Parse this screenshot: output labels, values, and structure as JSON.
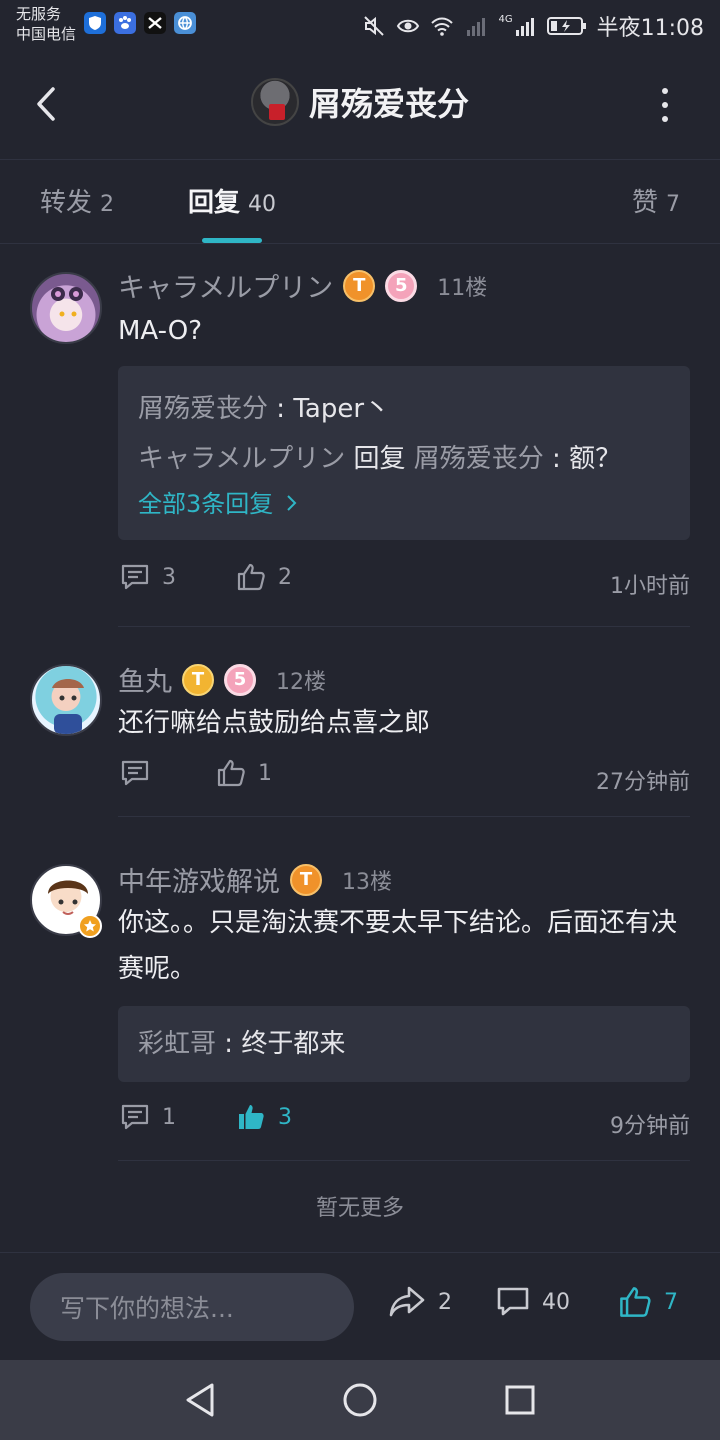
{
  "status_bar": {
    "carrier_line1": "无服务",
    "carrier_line2": "中国电信",
    "time": "半夜11:08",
    "network": "4G"
  },
  "header": {
    "title": "屑殇爱丧分"
  },
  "tabs": [
    {
      "label": "转发",
      "count": "2"
    },
    {
      "label": "回复",
      "count": "40",
      "active": true
    },
    {
      "label": "赞",
      "count": "7"
    }
  ],
  "comments": [
    {
      "username": "キャラメルプリン",
      "floor": "11楼",
      "text": "MA-O?",
      "replies": [
        {
          "name": "屑殇爱丧分",
          "sep": " : ",
          "text": "Taper丶"
        },
        {
          "name": "キャラメルプリン",
          "mid": " 回复 ",
          "name2": "屑殇爱丧分",
          "sep": " : ",
          "text": "额？"
        }
      ],
      "more_replies": "全部3条回复",
      "comment_count": "3",
      "like_count": "2",
      "time": "1小时前"
    },
    {
      "username": "鱼丸",
      "floor": "12楼",
      "text": "还行嘛给点鼓励给点喜之郎",
      "comment_count": "",
      "like_count": "1",
      "time": "27分钟前"
    },
    {
      "username": "中年游戏解说",
      "floor": "13楼",
      "text": "你这。。只是淘汰赛不要太早下结论。后面还有决赛呢。",
      "replies": [
        {
          "name": "彩虹哥",
          "sep": " : ",
          "text": "终于都来"
        }
      ],
      "comment_count": "1",
      "like_count": "3",
      "liked": true,
      "time": "9分钟前"
    }
  ],
  "end_note": "暂无更多",
  "bottom_bar": {
    "input_placeholder": "写下你的想法...",
    "share_count": "2",
    "comment_count": "40",
    "like_count": "7"
  },
  "badges": {
    "t_badge": "T",
    "level_badge": "5"
  },
  "colors": {
    "background": "#23252f",
    "accent": "#2fb6c6",
    "card": "#30333f"
  }
}
